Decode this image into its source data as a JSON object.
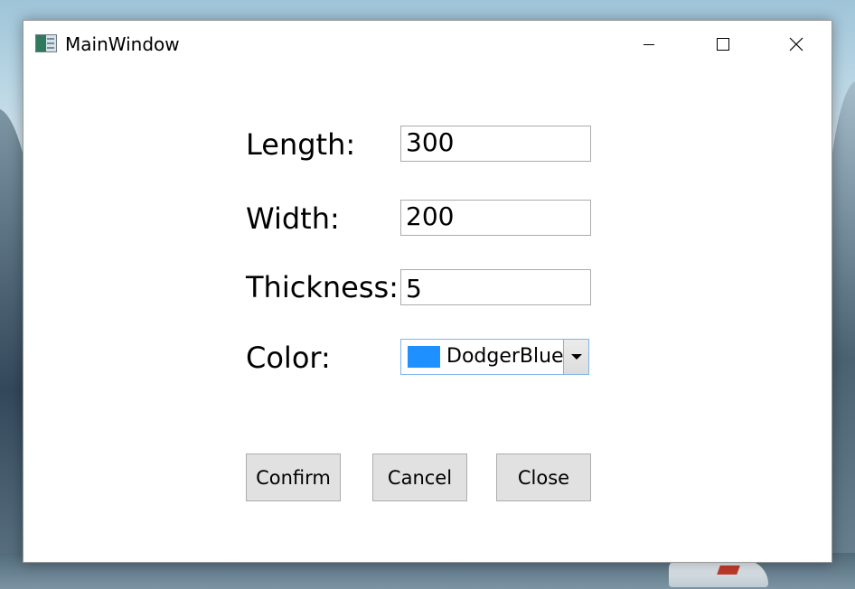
{
  "window": {
    "title": "MainWindow"
  },
  "form": {
    "length": {
      "label": "Length:",
      "value": "300"
    },
    "width": {
      "label": "Width:",
      "value": "200"
    },
    "thickness": {
      "label": "Thickness:",
      "value": "5"
    },
    "color": {
      "label": "Color:",
      "selected": "DodgerBlue",
      "swatch": "#1e90ff"
    }
  },
  "buttons": {
    "confirm": "Confirm",
    "cancel": "Cancel",
    "close": "Close"
  },
  "icons": {
    "app": "app-window-icon",
    "minimize": "minimize-icon",
    "maximize": "maximize-icon",
    "close": "close-icon",
    "dropdown": "chevron-down-icon"
  }
}
